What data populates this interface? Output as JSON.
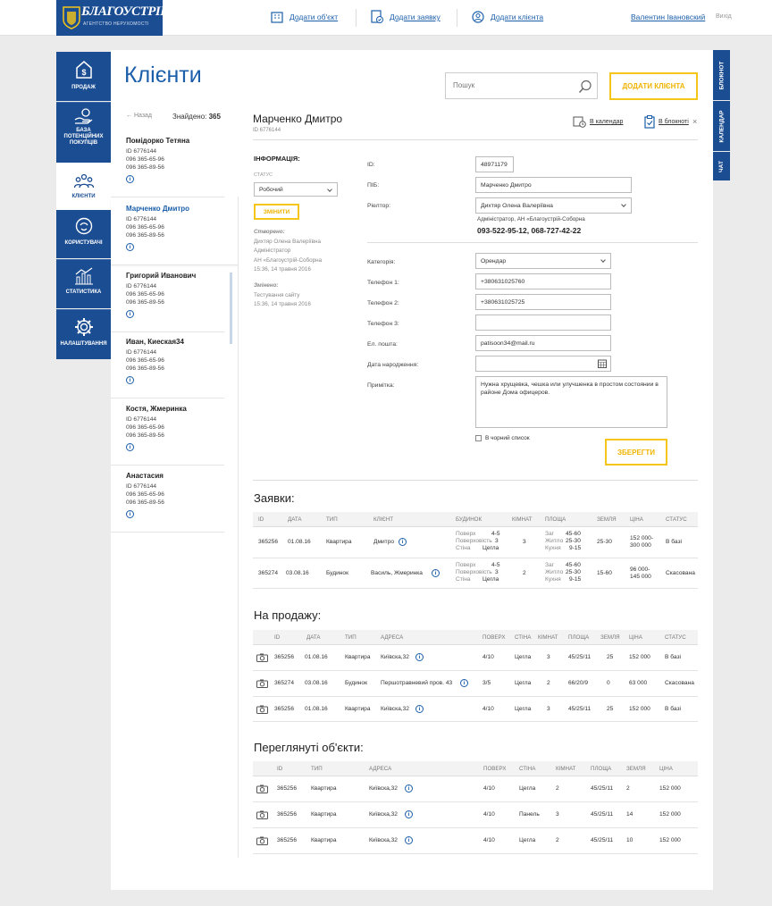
{
  "logo": {
    "title": "БЛАГОУСТРІЙ",
    "subtitle": "АГЕНТСТВО НЕРУХОМОСТІ"
  },
  "topnav": {
    "add_object": "Додати об'єкт",
    "add_request": "Додати заявку",
    "add_client": "Додати клієнта",
    "user": "Валентин Івановский",
    "logout": "Вихід"
  },
  "sidenav": [
    {
      "label": "ПРОДАЖ",
      "icon": "house-dollar-icon"
    },
    {
      "label": "БАЗА ПОТЕНЦІЙНИХ ПОКУПЦІВ",
      "icon": "hand-coin-icon"
    },
    {
      "label": "КЛІЄНТИ",
      "icon": "people-icon"
    },
    {
      "label": "КОРИСТУВАЧІ",
      "icon": "user-face-icon"
    },
    {
      "label": "СТАТИСТИКА",
      "icon": "bar-chart-icon"
    },
    {
      "label": "НАЛАШТУВАННЯ",
      "icon": "gear-icon"
    }
  ],
  "righttabs": [
    "БЛОКНОТ",
    "КАЛЕНДАР",
    "ЧАТ"
  ],
  "page": {
    "title": "Клієнти",
    "search_placeholder": "Пошук",
    "add_client_btn": "ДОДАТИ КЛІЄНТА",
    "back": "← Назад",
    "found_label": "Знайдено:",
    "found_count": "365"
  },
  "clients": [
    {
      "name": "Помідорко Тетяна",
      "id": "ID 6776144",
      "phone1": "096 365-65-96",
      "phone2": "096 365-89-56"
    },
    {
      "name": "Марченко Дмитро",
      "id": "ID 6776144",
      "phone1": "096 365-65-96",
      "phone2": "096 365-89-56"
    },
    {
      "name": "Григорий Иванович",
      "id": "ID 6776144",
      "phone1": "096 365-65-96",
      "phone2": "096 365-89-56"
    },
    {
      "name": "Иван, Киеская34",
      "id": "ID 6776144",
      "phone1": "096 365-65-96",
      "phone2": "096 365-89-56"
    },
    {
      "name": "Костя, Жмеринка",
      "id": "ID 6776144",
      "phone1": "096 365-65-96",
      "phone2": "096 365-89-56"
    },
    {
      "name": "Анастасия",
      "id": "ID 6776144",
      "phone1": "096 365-65-96",
      "phone2": "096 365-89-56"
    }
  ],
  "detail": {
    "name": "Марченко Дмитро",
    "id": "ID 6776144",
    "calendar": "В календар",
    "notebook": "В блокноті",
    "close": "×",
    "info_heading": "ІНФОРМАЦІЯ:",
    "status_label": "СТАТУС",
    "status_value": "Робочий",
    "change_btn": "ЗМІНИТИ",
    "created_label": "Створено:",
    "created_by": "Дихтяр Олена Валеріївна",
    "created_role": "Адміністратор",
    "created_agency": "АН «Благоустрій-Соборна",
    "created_date": "15:36, 14 травня 2016",
    "changed_label": "Змінено:",
    "changed_by": "Тестування сайту",
    "changed_date": "15:36, 14 травня 2016",
    "fields": {
      "id_label": "ID:",
      "id_value": "48971179",
      "pib_label": "ПІБ:",
      "pib_value": "Марченко Дмитро",
      "realtor_label": "Ріелтор:",
      "realtor_value": "Дихтяр Олена Валеріївна",
      "realtor_org": "Адміністратор, АН «Благоустрій-Соборна",
      "realtor_phones": "093-522-95-12, 068-727-42-22",
      "category_label": "Категорія:",
      "category_value": "Орендар",
      "phone1_label": "Телефон 1:",
      "phone1_value": "+380631025760",
      "phone2_label": "Телефон 2:",
      "phone2_value": "+380631025725",
      "phone3_label": "Телефон 3:",
      "phone3_value": "",
      "email_label": "Ел. пошта:",
      "email_value": "patisoon34@mail.ru",
      "birth_label": "Дата народження:",
      "birth_value": "",
      "note_label": "Примітка:",
      "note_value": "Нужна хрущевка, чешка или улучшенка в простом состоянии в районе Дома офицеров.",
      "blacklist_label": "В чорний список",
      "save_btn": "ЗБЕРЕГТИ"
    }
  },
  "requests": {
    "title": "Заявки:",
    "headers": [
      "ID",
      "ДАТА",
      "ТИП",
      "КЛІЄНТ",
      "БУДИНОК",
      "КІМНАТ",
      "ПЛОЩА",
      "ЗЕМЛЯ",
      "ЦІНА",
      "СТАТУС"
    ],
    "rows": [
      {
        "id": "365256",
        "date": "01.08.16",
        "type": "Квартира",
        "client": "Дмитро",
        "floor_l": "Поверх",
        "floor": "4-5",
        "floors_l": "Поверховість",
        "floors": "3",
        "wall_l": "Стіна",
        "wall": "Цегла",
        "rooms": "3",
        "area_total_l": "Заг",
        "area_total": "45-60",
        "area_live_l": "Житло",
        "area_live": "25-30",
        "area_kitchen_l": "Кухня",
        "area_kitchen": "9-15",
        "land": "25-30",
        "price1": "152 000-",
        "price2": "300 000",
        "status": "В базі"
      },
      {
        "id": "365274",
        "date": "03.08.16",
        "type": "Будинок",
        "client": "Василь, Жмеринка",
        "floor_l": "Поверх",
        "floor": "4-5",
        "floors_l": "Поверховість",
        "floors": "3",
        "wall_l": "Стіна",
        "wall": "Цегла",
        "rooms": "2",
        "area_total_l": "Заг",
        "area_total": "45-60",
        "area_live_l": "Житло",
        "area_live": "25-30",
        "area_kitchen_l": "Кухня",
        "area_kitchen": "9-15",
        "land": "15-60",
        "price1": "96 000-",
        "price2": "145 000",
        "status": "Скасована"
      }
    ]
  },
  "forsale": {
    "title": "На продажу:",
    "headers": [
      "ID",
      "ДАТА",
      "ТИП",
      "АДРЕСА",
      "ПОВЕРХ",
      "СТІНА",
      "КІМНАТ",
      "ПЛОЩА",
      "ЗЕМЛЯ",
      "ЦІНА",
      "СТАТУС"
    ],
    "rows": [
      {
        "id": "365256",
        "date": "01.08.16",
        "type": "Квартира",
        "address": "Київска,32",
        "floor": "4/10",
        "wall": "Цегла",
        "rooms": "3",
        "area": "45/25/11",
        "land": "25",
        "price": "152 000",
        "status": "В базі"
      },
      {
        "id": "365274",
        "date": "03.08.16",
        "type": "Будинок",
        "address": "Першотравневий пров. 43",
        "floor": "3/5",
        "wall": "Цегла",
        "rooms": "2",
        "area": "66/20/9",
        "land": "0",
        "price": "63 000",
        "status": "Скасована"
      },
      {
        "id": "365256",
        "date": "01.08.16",
        "type": "Квартира",
        "address": "Київска,32",
        "floor": "4/10",
        "wall": "Цегла",
        "rooms": "3",
        "area": "45/25/11",
        "land": "25",
        "price": "152 000",
        "status": "В базі"
      }
    ]
  },
  "viewed": {
    "title": "Переглянуті об'єкти:",
    "headers": [
      "ID",
      "ТИП",
      "АДРЕСА",
      "ПОВЕРХ",
      "СТІНА",
      "КІМНАТ",
      "ПЛОЩА",
      "ЗЕМЛЯ",
      "ЦІНА"
    ],
    "rows": [
      {
        "id": "365256",
        "type": "Квартира",
        "address": "Київска,32",
        "floor": "4/10",
        "wall": "Цегла",
        "rooms": "2",
        "area": "45/25/11",
        "land": "2",
        "price": "152 000"
      },
      {
        "id": "365256",
        "type": "Квартира",
        "address": "Київска,32",
        "floor": "4/10",
        "wall": "Панель",
        "rooms": "3",
        "area": "45/25/11",
        "land": "14",
        "price": "152 000"
      },
      {
        "id": "365256",
        "type": "Квартира",
        "address": "Київска,32",
        "floor": "4/10",
        "wall": "Цегла",
        "rooms": "2",
        "area": "45/25/11",
        "land": "10",
        "price": "152 000"
      }
    ]
  },
  "colors": {
    "brand": "#1b4d92",
    "link": "#1b5fab",
    "accent": "#f5c518"
  }
}
